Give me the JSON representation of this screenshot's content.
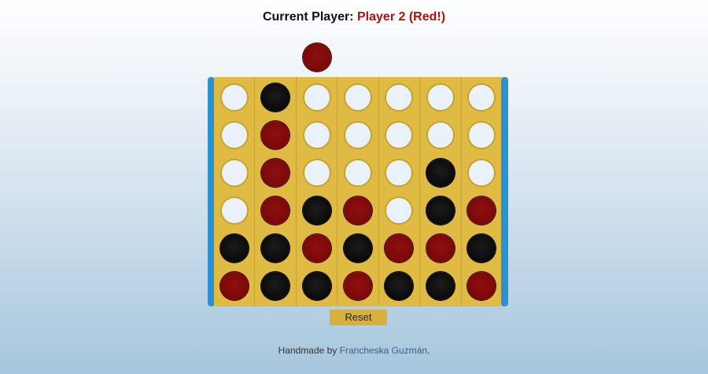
{
  "status": {
    "label": "Current Player:",
    "player": "Player 2 (Red!)"
  },
  "hover_disc": {
    "color": "red",
    "column": 3
  },
  "board": {
    "columns": 7,
    "rows": 6,
    "cells": [
      [
        "empty",
        "black",
        "empty",
        "empty",
        "empty",
        "empty",
        "empty"
      ],
      [
        "empty",
        "red",
        "empty",
        "empty",
        "empty",
        "empty",
        "empty"
      ],
      [
        "empty",
        "red",
        "empty",
        "empty",
        "empty",
        "black",
        "empty"
      ],
      [
        "empty",
        "red",
        "black",
        "red",
        "empty",
        "black",
        "red"
      ],
      [
        "black",
        "black",
        "red",
        "black",
        "red",
        "red",
        "black"
      ],
      [
        "red",
        "black",
        "black",
        "red",
        "black",
        "black",
        "red"
      ]
    ]
  },
  "reset": {
    "label": "Reset"
  },
  "footer": {
    "prefix": "Handmade by ",
    "author": "Francheska Guzmán",
    "suffix": "."
  },
  "colors": {
    "red_disc": "#7a0808",
    "black_disc": "#0a0a0a",
    "board": "#e0bb44",
    "rail": "#2a92d0",
    "current_player_text": "#b30f0f"
  }
}
